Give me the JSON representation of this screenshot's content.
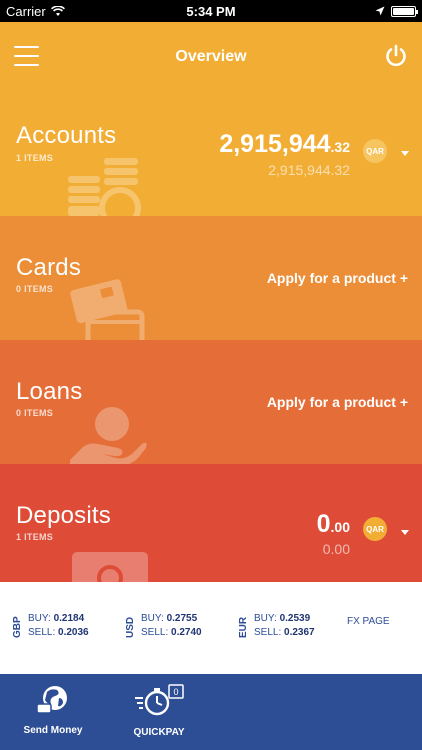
{
  "status_bar": {
    "carrier": "Carrier",
    "time": "5:34 PM"
  },
  "header": {
    "title": "Overview"
  },
  "accounts": {
    "title": "Accounts",
    "count": "1 ITEMS",
    "balance_int": "2,915,944",
    "balance_dec": ".32",
    "balance_sub": "2,915,944.32",
    "currency": "QAR"
  },
  "cards": {
    "title": "Cards",
    "count": "0 ITEMS",
    "action": "Apply for a product +"
  },
  "loans": {
    "title": "Loans",
    "count": "0 ITEMS",
    "action": "Apply for a product +"
  },
  "deposits": {
    "title": "Deposits",
    "count": "1 ITEMS",
    "balance_int": "0",
    "balance_dec": ".00",
    "balance_sub": "0.00",
    "currency": "QAR"
  },
  "fx": {
    "rates": [
      {
        "code": "GBP",
        "buy_label": "BUY:",
        "buy": "0.2184",
        "sell_label": "SELL:",
        "sell": "0.2036"
      },
      {
        "code": "USD",
        "buy_label": "BUY:",
        "buy": "0.2755",
        "sell_label": "SELL:",
        "sell": "0.2740"
      },
      {
        "code": "EUR",
        "buy_label": "BUY:",
        "buy": "0.2539",
        "sell_label": "SELL:",
        "sell": "0.2367"
      }
    ],
    "page_link": "FX PAGE"
  },
  "bottom_nav": {
    "send_money": "Send Money",
    "quickpay": "QUICKPAY",
    "quickpay_badge": "0"
  },
  "colors": {
    "accounts": "#f2ad35",
    "cards": "#ec8d37",
    "loans": "#e56d38",
    "deposits": "#de4c37",
    "bottom_bar": "#2d4e94"
  }
}
